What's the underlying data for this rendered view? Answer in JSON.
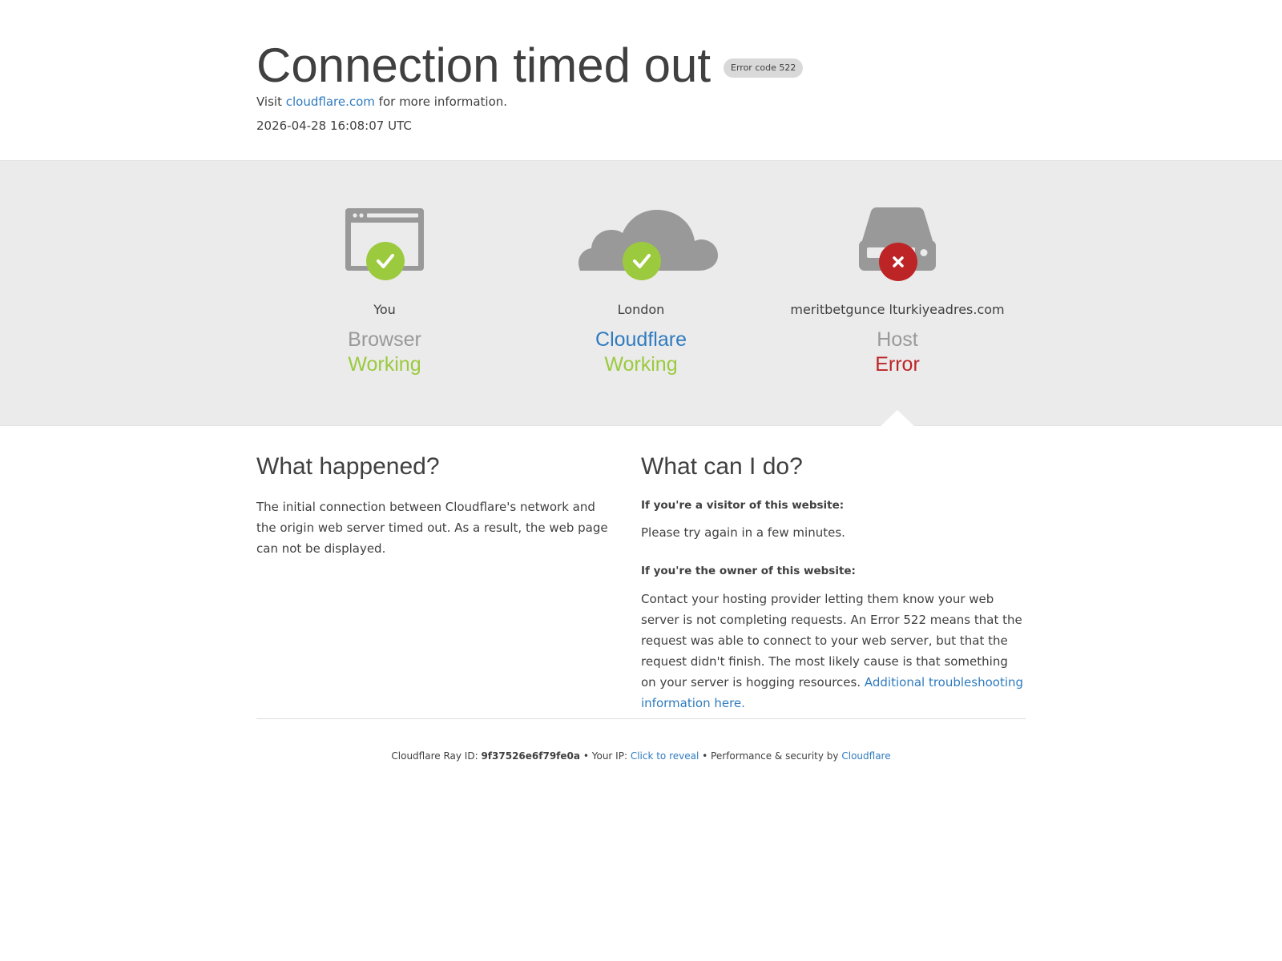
{
  "header": {
    "title": "Connection timed out",
    "error_badge": "Error code 522",
    "visit_prefix": "Visit",
    "visit_link": "cloudflare.com",
    "visit_suffix": "for more information.",
    "timestamp": "2026-04-28 16:08:07 UTC"
  },
  "status": {
    "browser": {
      "location": "You",
      "role": "Browser",
      "state": "Working",
      "icon": "browser-icon",
      "badge": "check"
    },
    "cloudflare": {
      "location": "London",
      "role": "Cloudflare",
      "state": "Working",
      "icon": "cloud-icon",
      "badge": "check"
    },
    "host": {
      "location": "meritbetgunce lturkiyeadres.com",
      "role": "Host",
      "state": "Error",
      "icon": "server-icon",
      "badge": "x"
    }
  },
  "what_happened": {
    "heading": "What happened?",
    "body": "The initial connection between Cloudflare's network and the origin web server timed out. As a result, the web page can not be displayed."
  },
  "what_can_i_do": {
    "heading": "What can I do?",
    "visitor_heading": "If you're a visitor of this website:",
    "visitor_body": "Please try again in a few minutes.",
    "owner_heading": "If you're the owner of this website:",
    "owner_body": "Contact your hosting provider letting them know your web server is not completing requests. An Error 522 means that the request was able to connect to your web server, but that the request didn't finish. The most likely cause is that something on your server is hogging resources.",
    "owner_link": "Additional troubleshooting information here."
  },
  "footer": {
    "ray_label": "Cloudflare Ray ID:",
    "ray_id": "9f37526e6f79fe0a",
    "sep1": "•",
    "ip_label": "Your IP:",
    "ip_link": "Click to reveal",
    "sep2": "•",
    "perf_label": "Performance & security by",
    "perf_link": "Cloudflare"
  },
  "colors": {
    "working": "#9bca3e",
    "error": "#bd2426",
    "link": "#2f7bbf",
    "icon_gray": "#999999",
    "band": "#ebebeb"
  }
}
